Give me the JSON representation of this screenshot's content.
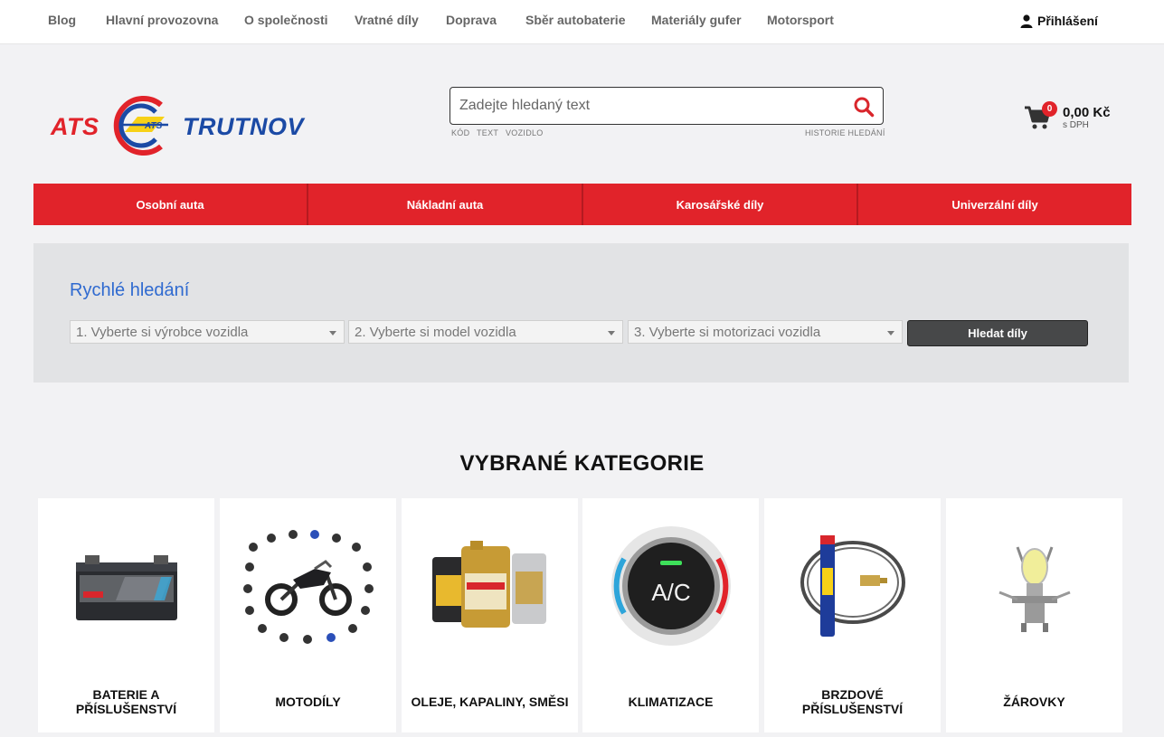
{
  "topnav": {
    "links": [
      "Blog",
      "Hlavní provozovna",
      "O společnosti",
      "Vratné díly",
      "Doprava",
      "Sběr autobaterie",
      "Materiály gufer",
      "Motorsport"
    ],
    "login_label": "Přihlášení"
  },
  "logo": {
    "left_text": "ATS",
    "right_text": "TRUTNOV",
    "emblem_text": "ATS"
  },
  "search": {
    "placeholder": "Zadejte hledaný text",
    "hints": [
      "KÓD",
      "TEXT",
      "VOZIDLO"
    ],
    "history_label": "HISTORIE HLEDÁNÍ"
  },
  "cart": {
    "count": "0",
    "price": "0,00 Kč",
    "vat_note": "s DPH"
  },
  "categories": [
    "Osobní auta",
    "Nákladní auta",
    "Karosářské díly",
    "Univerzální díly"
  ],
  "quick_search": {
    "title": "Rychlé hledání",
    "selects": [
      "1. Vyberte si výrobce vozidla",
      "2. Vyberte si model vozidla",
      "3. Vyberte si motorizaci vozidla"
    ],
    "button_label": "Hledat díly"
  },
  "featured": {
    "title": "VYBRANÉ KATEGORIE",
    "cards": [
      {
        "label": "BATERIE A PŘÍSLUŠENSTVÍ",
        "icon": "battery-image"
      },
      {
        "label": "MOTODÍLY",
        "icon": "motorcycle-image"
      },
      {
        "label": "OLEJE, KAPALINY, SMĚSI",
        "icon": "oil-canisters-image"
      },
      {
        "label": "KLIMATIZACE",
        "icon": "ac-button-image",
        "icon_text": "A/C"
      },
      {
        "label": "BRZDOVÉ PŘÍSLUŠENSTVÍ",
        "icon": "brake-accessories-image"
      },
      {
        "label": "ŽÁROVKY",
        "icon": "bulb-image"
      }
    ]
  },
  "colors": {
    "brand_red": "#e1232a",
    "brand_blue": "#1b4aa5",
    "link_blue": "#2f6ad0"
  }
}
